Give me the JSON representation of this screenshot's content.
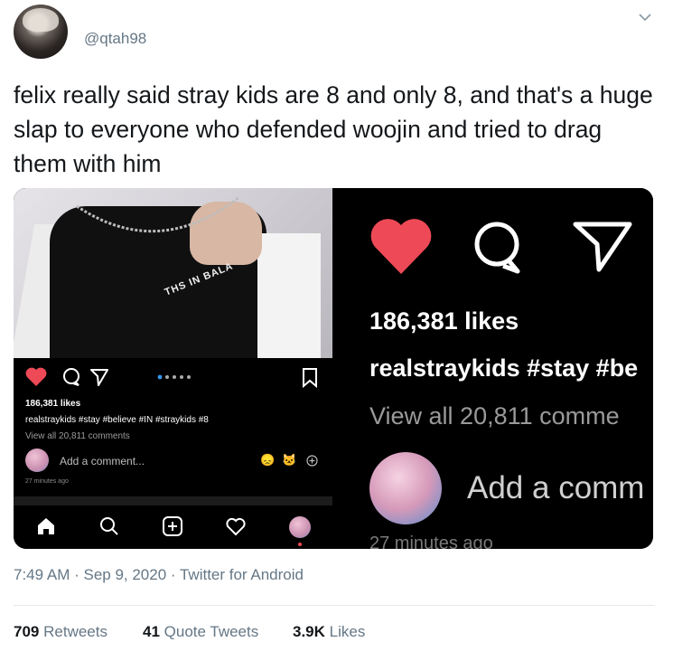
{
  "tweet": {
    "handle": "@qtah98",
    "text": "felix really said stray kids are 8 and only 8, and that's a huge slap to everyone who defended woojin and tried to drag them with him",
    "meta": "7:49 AM · Sep 9, 2020 · Twitter for Android",
    "stats": {
      "retweets_count": "709",
      "retweets_label": "Retweets",
      "quotes_count": "41",
      "quotes_label": "Quote Tweets",
      "likes_count": "3.9K",
      "likes_label": "Likes"
    }
  },
  "left_image": {
    "shirt_text": "THS IN BALA",
    "likes": "186,381 likes",
    "caption": "realstraykids #stay #believe #IN #straykids #8",
    "view_comments": "View all 20,811 comments",
    "add_comment": "Add a comment...",
    "time": "27 minutes ago",
    "emoji1": "😞",
    "emoji2": "🐱"
  },
  "right_image": {
    "likes": "186,381 likes",
    "caption": "realstraykids #stay #be",
    "view_comments": "View all 20,811 comme",
    "add_comment": "Add a comm",
    "time": "27 minutes ago"
  },
  "colors": {
    "heart": "#ed4956",
    "muted": "#657786",
    "carousel_dot": "#3897f0"
  }
}
